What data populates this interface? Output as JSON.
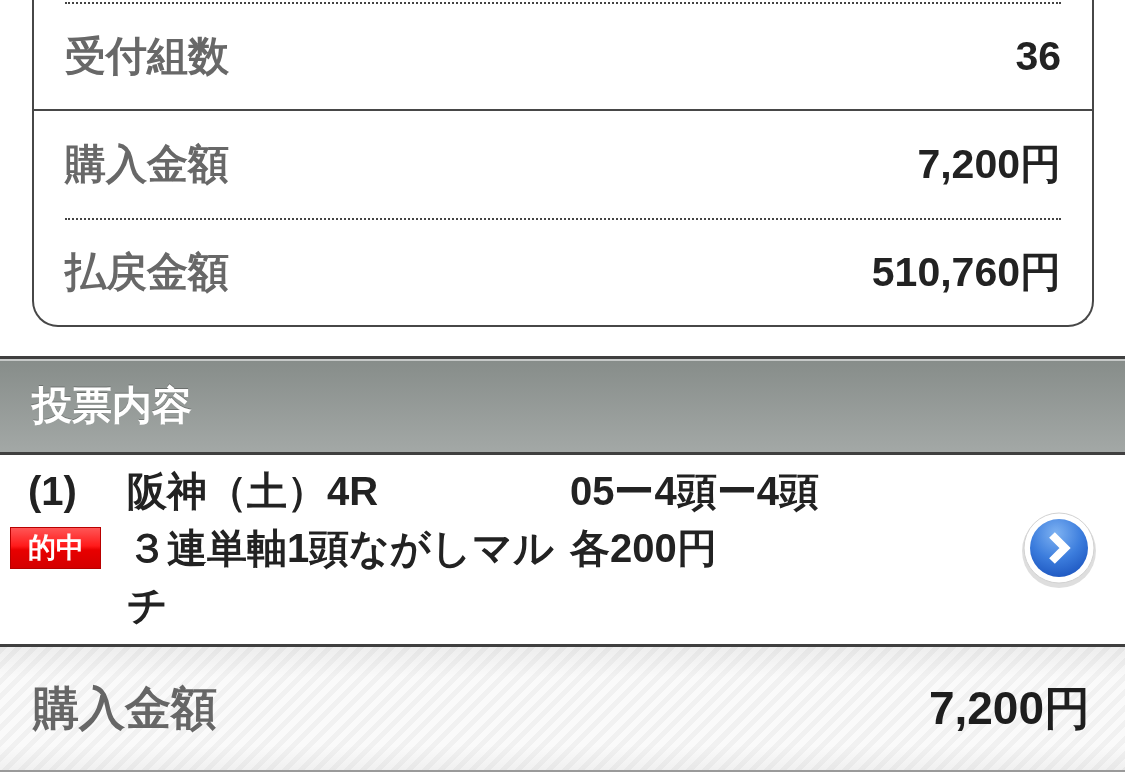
{
  "summary": {
    "sections": [
      {
        "rows": [
          {
            "label": "受付組数",
            "value": "36"
          }
        ]
      },
      {
        "rows": [
          {
            "label": "購入金額",
            "value": "7,200円"
          },
          {
            "label": "払戻金額",
            "value": "510,760円"
          }
        ]
      }
    ]
  },
  "bet_details": {
    "title": "投票内容",
    "items": [
      {
        "number": "(1)",
        "badge": "的中",
        "race": "阪神（土）4R",
        "bet_type": "３連単軸1頭ながしマルチ",
        "combination": "05ー4頭ー4頭",
        "amount": "各200円"
      }
    ]
  },
  "total": {
    "label": "購入金額",
    "value": "7,200円"
  }
}
